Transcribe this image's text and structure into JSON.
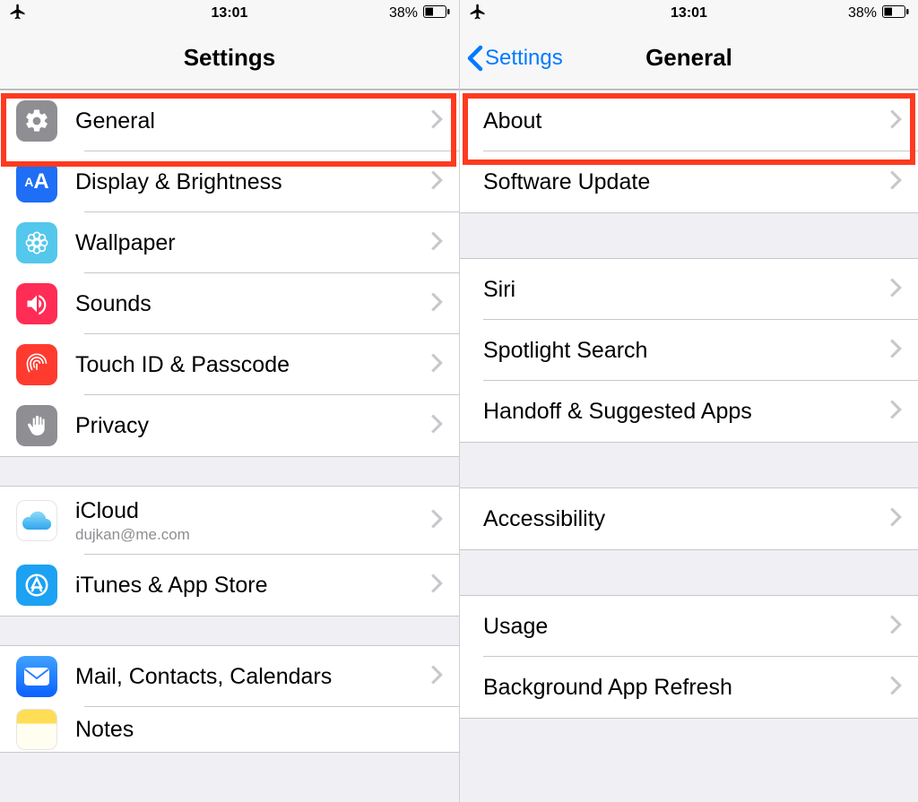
{
  "status": {
    "time": "13:01",
    "battery_text": "38%"
  },
  "left": {
    "title": "Settings",
    "groups": [
      {
        "rows": [
          {
            "key": "general",
            "label": "General"
          },
          {
            "key": "display",
            "label": "Display & Brightness"
          },
          {
            "key": "wallpaper",
            "label": "Wallpaper"
          },
          {
            "key": "sounds",
            "label": "Sounds"
          },
          {
            "key": "touchid",
            "label": "Touch ID & Passcode"
          },
          {
            "key": "privacy",
            "label": "Privacy"
          }
        ]
      },
      {
        "rows": [
          {
            "key": "icloud",
            "label": "iCloud",
            "sub": "dujkan@me.com"
          },
          {
            "key": "itunes",
            "label": "iTunes & App Store"
          }
        ]
      },
      {
        "rows": [
          {
            "key": "mail",
            "label": "Mail, Contacts, Calendars"
          },
          {
            "key": "notes",
            "label": "Notes"
          }
        ]
      }
    ]
  },
  "right": {
    "back": "Settings",
    "title": "General",
    "groups": [
      {
        "rows": [
          {
            "label": "About"
          },
          {
            "label": "Software Update"
          }
        ]
      },
      {
        "rows": [
          {
            "label": "Siri"
          },
          {
            "label": "Spotlight Search"
          },
          {
            "label": "Handoff & Suggested Apps"
          }
        ]
      },
      {
        "rows": [
          {
            "label": "Accessibility"
          }
        ]
      },
      {
        "rows": [
          {
            "label": "Usage"
          },
          {
            "label": "Background App Refresh"
          }
        ]
      }
    ]
  }
}
